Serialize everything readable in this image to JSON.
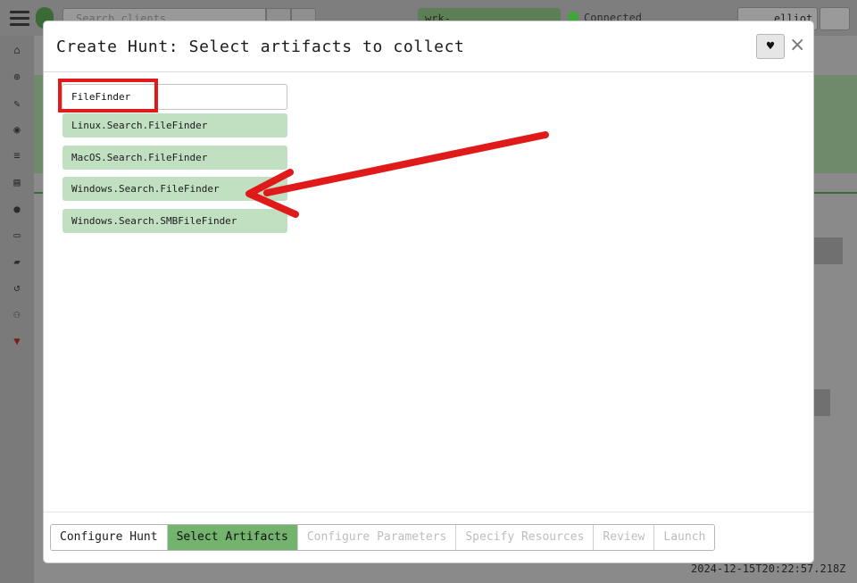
{
  "background": {
    "search_placeholder": "Search clients",
    "client_host": "wrk-price.ECorp.local",
    "connection_status": "Connected",
    "user_name": "elliot",
    "timestamp": "2024-12-15T20:22:57.218Z",
    "sidebar_icons": [
      "home-icon",
      "crosshair-icon",
      "wrench-icon",
      "eye-icon",
      "server-icon",
      "book-icon",
      "user-icon",
      "laptop-icon",
      "folder-icon",
      "history-icon",
      "binoculars-icon",
      "shield-icon"
    ]
  },
  "modal": {
    "title": "Create Hunt: Select artifacts to collect",
    "search_value": "FileFinder",
    "artifacts": [
      "Linux.Search.FileFinder",
      "MacOS.Search.FileFinder",
      "Windows.Search.FileFinder",
      "Windows.Search.SMBFileFinder"
    ],
    "steps": [
      {
        "label": "Configure Hunt",
        "state": "done"
      },
      {
        "label": "Select Artifacts",
        "state": "active"
      },
      {
        "label": "Configure Parameters",
        "state": "disabled"
      },
      {
        "label": "Specify Resources",
        "state": "disabled"
      },
      {
        "label": "Review",
        "state": "disabled"
      },
      {
        "label": "Launch",
        "state": "disabled"
      }
    ]
  },
  "colors": {
    "artifact_bg": "#c1dfc1",
    "active_step": "#73b36d",
    "annotation_red": "#e01a1a"
  }
}
